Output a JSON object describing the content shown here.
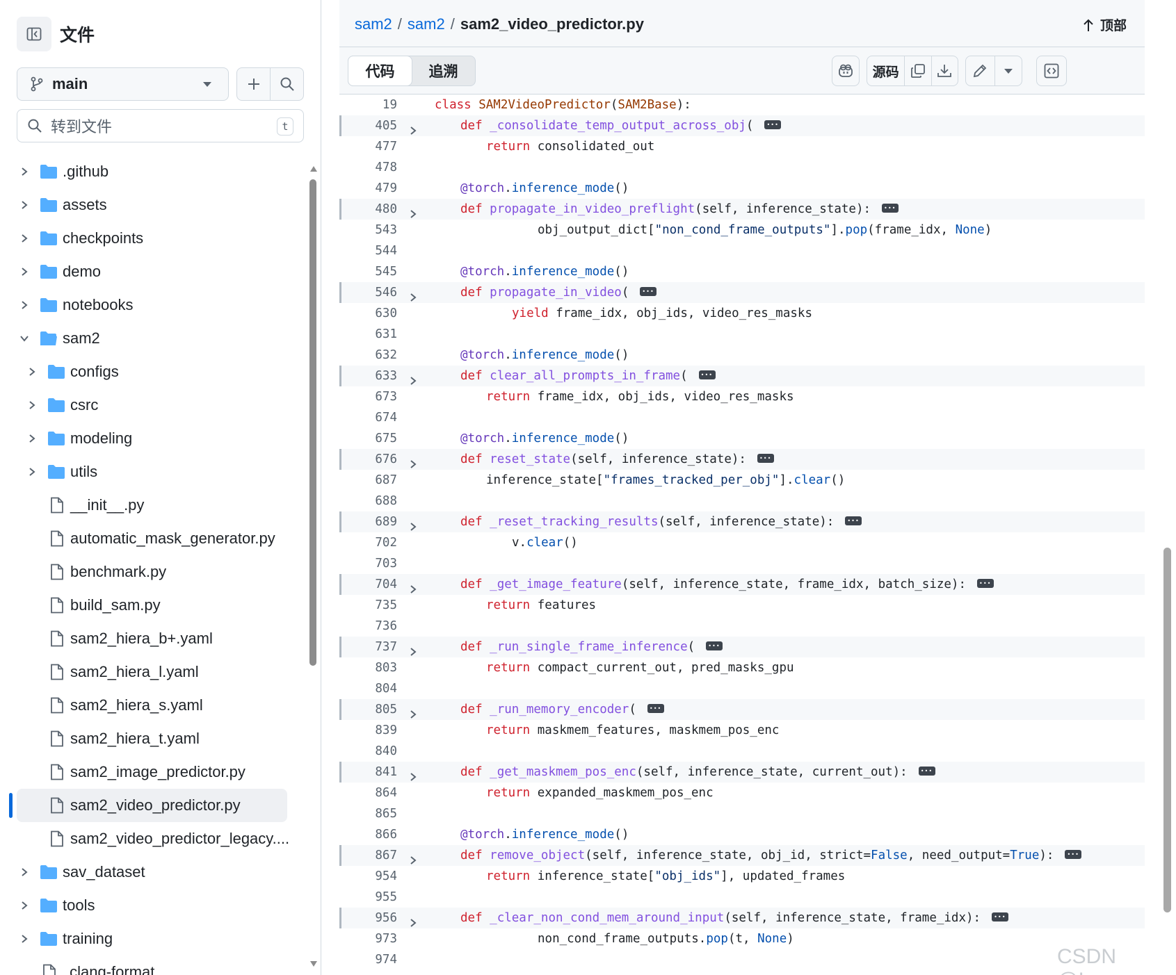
{
  "sidebar": {
    "title": "文件",
    "branch": "main",
    "goto_placeholder": "转到文件",
    "goto_shortcut": "t",
    "tree": [
      {
        "label": ".github",
        "type": "folder",
        "depth": 0,
        "state": "collapsed"
      },
      {
        "label": "assets",
        "type": "folder",
        "depth": 0,
        "state": "collapsed"
      },
      {
        "label": "checkpoints",
        "type": "folder",
        "depth": 0,
        "state": "collapsed"
      },
      {
        "label": "demo",
        "type": "folder",
        "depth": 0,
        "state": "collapsed"
      },
      {
        "label": "notebooks",
        "type": "folder",
        "depth": 0,
        "state": "collapsed"
      },
      {
        "label": "sam2",
        "type": "folder",
        "depth": 0,
        "state": "expanded"
      },
      {
        "label": "configs",
        "type": "folder",
        "depth": 1,
        "state": "collapsed"
      },
      {
        "label": "csrc",
        "type": "folder",
        "depth": 1,
        "state": "collapsed"
      },
      {
        "label": "modeling",
        "type": "folder",
        "depth": 1,
        "state": "collapsed"
      },
      {
        "label": "utils",
        "type": "folder",
        "depth": 1,
        "state": "collapsed"
      },
      {
        "label": "__init__.py",
        "type": "file",
        "depth": 1
      },
      {
        "label": "automatic_mask_generator.py",
        "type": "file",
        "depth": 1
      },
      {
        "label": "benchmark.py",
        "type": "file",
        "depth": 1
      },
      {
        "label": "build_sam.py",
        "type": "file",
        "depth": 1
      },
      {
        "label": "sam2_hiera_b+.yaml",
        "type": "file",
        "depth": 1
      },
      {
        "label": "sam2_hiera_l.yaml",
        "type": "file",
        "depth": 1
      },
      {
        "label": "sam2_hiera_s.yaml",
        "type": "file",
        "depth": 1
      },
      {
        "label": "sam2_hiera_t.yaml",
        "type": "file",
        "depth": 1
      },
      {
        "label": "sam2_image_predictor.py",
        "type": "file",
        "depth": 1
      },
      {
        "label": "sam2_video_predictor.py",
        "type": "file",
        "depth": 1,
        "selected": true
      },
      {
        "label": "sam2_video_predictor_legacy....",
        "type": "file",
        "depth": 1
      },
      {
        "label": "sav_dataset",
        "type": "folder",
        "depth": 0,
        "state": "collapsed"
      },
      {
        "label": "tools",
        "type": "folder",
        "depth": 0,
        "state": "collapsed"
      },
      {
        "label": "training",
        "type": "folder",
        "depth": 0,
        "state": "collapsed"
      },
      {
        "label": ".clang-format",
        "type": "file",
        "depth": 0
      }
    ]
  },
  "header": {
    "breadcrumb": [
      "sam2",
      "sam2"
    ],
    "separator": "/",
    "current_file": "sam2_video_predictor.py",
    "top_label": "顶部"
  },
  "toolbar": {
    "tab_code": "代码",
    "tab_blame": "追溯",
    "raw_label": "源码"
  },
  "code_lines": [
    {
      "n": "19",
      "fold": false,
      "segs": [
        [
          "kw",
          "class "
        ],
        [
          "cn",
          "SAM2VideoPredictor"
        ],
        [
          "",
          "("
        ],
        [
          "cn",
          "SAM2Base"
        ],
        [
          "",
          "):"
        ]
      ],
      "indent": 0
    },
    {
      "n": "405",
      "fold": true,
      "segs": [
        [
          "kw",
          "def "
        ],
        [
          "fn",
          "_consolidate_temp_output_across_obj"
        ],
        [
          "",
          "("
        ]
      ],
      "indent": 1,
      "dots": true
    },
    {
      "n": "477",
      "fold": false,
      "segs": [
        [
          "kw",
          "return "
        ],
        [
          "",
          "consolidated_out"
        ]
      ],
      "indent": 2
    },
    {
      "n": "478",
      "fold": false,
      "segs": [],
      "indent": 0
    },
    {
      "n": "479",
      "fold": false,
      "segs": [
        [
          "dc",
          "@torch"
        ],
        [
          "",
          "."
        ],
        [
          "bl",
          "inference_mode"
        ],
        [
          "",
          "()"
        ]
      ],
      "indent": 1
    },
    {
      "n": "480",
      "fold": true,
      "segs": [
        [
          "kw",
          "def "
        ],
        [
          "fn",
          "propagate_in_video_preflight"
        ],
        [
          "",
          "(self, inference_state):"
        ]
      ],
      "indent": 1,
      "dots": true
    },
    {
      "n": "543",
      "fold": false,
      "segs": [
        [
          "",
          "obj_output_dict["
        ],
        [
          "st",
          "\"non_cond_frame_outputs\""
        ],
        [
          "",
          "]."
        ],
        [
          "bl",
          "pop"
        ],
        [
          "",
          "(frame_idx, "
        ],
        [
          "bl",
          "None"
        ],
        [
          "",
          ")"
        ]
      ],
      "indent": 4
    },
    {
      "n": "544",
      "fold": false,
      "segs": [],
      "indent": 0
    },
    {
      "n": "545",
      "fold": false,
      "segs": [
        [
          "dc",
          "@torch"
        ],
        [
          "",
          "."
        ],
        [
          "bl",
          "inference_mode"
        ],
        [
          "",
          "()"
        ]
      ],
      "indent": 1
    },
    {
      "n": "546",
      "fold": true,
      "segs": [
        [
          "kw",
          "def "
        ],
        [
          "fn",
          "propagate_in_video"
        ],
        [
          "",
          "("
        ]
      ],
      "indent": 1,
      "dots": true
    },
    {
      "n": "630",
      "fold": false,
      "segs": [
        [
          "kw",
          "yield "
        ],
        [
          "",
          "frame_idx, obj_ids, video_res_masks"
        ]
      ],
      "indent": 3
    },
    {
      "n": "631",
      "fold": false,
      "segs": [],
      "indent": 0
    },
    {
      "n": "632",
      "fold": false,
      "segs": [
        [
          "dc",
          "@torch"
        ],
        [
          "",
          "."
        ],
        [
          "bl",
          "inference_mode"
        ],
        [
          "",
          "()"
        ]
      ],
      "indent": 1
    },
    {
      "n": "633",
      "fold": true,
      "segs": [
        [
          "kw",
          "def "
        ],
        [
          "fn",
          "clear_all_prompts_in_frame"
        ],
        [
          "",
          "("
        ]
      ],
      "indent": 1,
      "dots": true
    },
    {
      "n": "673",
      "fold": false,
      "segs": [
        [
          "kw",
          "return "
        ],
        [
          "",
          "frame_idx, obj_ids, video_res_masks"
        ]
      ],
      "indent": 2
    },
    {
      "n": "674",
      "fold": false,
      "segs": [],
      "indent": 0
    },
    {
      "n": "675",
      "fold": false,
      "segs": [
        [
          "dc",
          "@torch"
        ],
        [
          "",
          "."
        ],
        [
          "bl",
          "inference_mode"
        ],
        [
          "",
          "()"
        ]
      ],
      "indent": 1
    },
    {
      "n": "676",
      "fold": true,
      "segs": [
        [
          "kw",
          "def "
        ],
        [
          "fn",
          "reset_state"
        ],
        [
          "",
          "(self, inference_state):"
        ]
      ],
      "indent": 1,
      "dots": true
    },
    {
      "n": "687",
      "fold": false,
      "segs": [
        [
          "",
          "inference_state["
        ],
        [
          "st",
          "\"frames_tracked_per_obj\""
        ],
        [
          "",
          "]."
        ],
        [
          "bl",
          "clear"
        ],
        [
          "",
          "()"
        ]
      ],
      "indent": 2
    },
    {
      "n": "688",
      "fold": false,
      "segs": [],
      "indent": 0
    },
    {
      "n": "689",
      "fold": true,
      "segs": [
        [
          "kw",
          "def "
        ],
        [
          "fn",
          "_reset_tracking_results"
        ],
        [
          "",
          "(self, inference_state):"
        ]
      ],
      "indent": 1,
      "dots": true
    },
    {
      "n": "702",
      "fold": false,
      "segs": [
        [
          "",
          "v."
        ],
        [
          "bl",
          "clear"
        ],
        [
          "",
          "()"
        ]
      ],
      "indent": 3
    },
    {
      "n": "703",
      "fold": false,
      "segs": [],
      "indent": 0
    },
    {
      "n": "704",
      "fold": true,
      "segs": [
        [
          "kw",
          "def "
        ],
        [
          "fn",
          "_get_image_feature"
        ],
        [
          "",
          "(self, inference_state, frame_idx, batch_size):"
        ]
      ],
      "indent": 1,
      "dots": true
    },
    {
      "n": "735",
      "fold": false,
      "segs": [
        [
          "kw",
          "return "
        ],
        [
          "",
          "features"
        ]
      ],
      "indent": 2
    },
    {
      "n": "736",
      "fold": false,
      "segs": [],
      "indent": 0
    },
    {
      "n": "737",
      "fold": true,
      "segs": [
        [
          "kw",
          "def "
        ],
        [
          "fn",
          "_run_single_frame_inference"
        ],
        [
          "",
          "("
        ]
      ],
      "indent": 1,
      "dots": true
    },
    {
      "n": "803",
      "fold": false,
      "segs": [
        [
          "kw",
          "return "
        ],
        [
          "",
          "compact_current_out, pred_masks_gpu"
        ]
      ],
      "indent": 2
    },
    {
      "n": "804",
      "fold": false,
      "segs": [],
      "indent": 0
    },
    {
      "n": "805",
      "fold": true,
      "segs": [
        [
          "kw",
          "def "
        ],
        [
          "fn",
          "_run_memory_encoder"
        ],
        [
          "",
          "("
        ]
      ],
      "indent": 1,
      "dots": true
    },
    {
      "n": "839",
      "fold": false,
      "segs": [
        [
          "kw",
          "return "
        ],
        [
          "",
          "maskmem_features, maskmem_pos_enc"
        ]
      ],
      "indent": 2
    },
    {
      "n": "840",
      "fold": false,
      "segs": [],
      "indent": 0
    },
    {
      "n": "841",
      "fold": true,
      "segs": [
        [
          "kw",
          "def "
        ],
        [
          "fn",
          "_get_maskmem_pos_enc"
        ],
        [
          "",
          "(self, inference_state, current_out):"
        ]
      ],
      "indent": 1,
      "dots": true
    },
    {
      "n": "864",
      "fold": false,
      "segs": [
        [
          "kw",
          "return "
        ],
        [
          "",
          "expanded_maskmem_pos_enc"
        ]
      ],
      "indent": 2
    },
    {
      "n": "865",
      "fold": false,
      "segs": [],
      "indent": 0
    },
    {
      "n": "866",
      "fold": false,
      "segs": [
        [
          "dc",
          "@torch"
        ],
        [
          "",
          "."
        ],
        [
          "bl",
          "inference_mode"
        ],
        [
          "",
          "()"
        ]
      ],
      "indent": 1
    },
    {
      "n": "867",
      "fold": true,
      "segs": [
        [
          "kw",
          "def "
        ],
        [
          "fn",
          "remove_object"
        ],
        [
          "",
          "(self, inference_state, obj_id, strict="
        ],
        [
          "bl",
          "False"
        ],
        [
          "",
          ", need_output="
        ],
        [
          "bl",
          "True"
        ],
        [
          "",
          "):"
        ]
      ],
      "indent": 1,
      "dots": true
    },
    {
      "n": "954",
      "fold": false,
      "segs": [
        [
          "kw",
          "return "
        ],
        [
          "",
          "inference_state["
        ],
        [
          "st",
          "\"obj_ids\""
        ],
        [
          "",
          "], updated_frames"
        ]
      ],
      "indent": 2
    },
    {
      "n": "955",
      "fold": false,
      "segs": [],
      "indent": 0
    },
    {
      "n": "956",
      "fold": true,
      "segs": [
        [
          "kw",
          "def "
        ],
        [
          "fn",
          "_clear_non_cond_mem_around_input"
        ],
        [
          "",
          "(self, inference_state, frame_idx):"
        ]
      ],
      "indent": 1,
      "dots": true
    },
    {
      "n": "973",
      "fold": false,
      "segs": [
        [
          "",
          "non_cond_frame_outputs."
        ],
        [
          "bl",
          "pop"
        ],
        [
          "",
          "(t, "
        ],
        [
          "bl",
          "None"
        ],
        [
          "",
          ")"
        ]
      ],
      "indent": 4
    },
    {
      "n": "974",
      "fold": false,
      "segs": [],
      "indent": 0
    }
  ],
  "watermark": "CSDN @Ivy_",
  "colors": {
    "link": "#0969da",
    "keyword": "#cf222e",
    "function": "#8250df",
    "builtin": "#0550ae",
    "string": "#0a3069",
    "folder": "#54aeff"
  }
}
